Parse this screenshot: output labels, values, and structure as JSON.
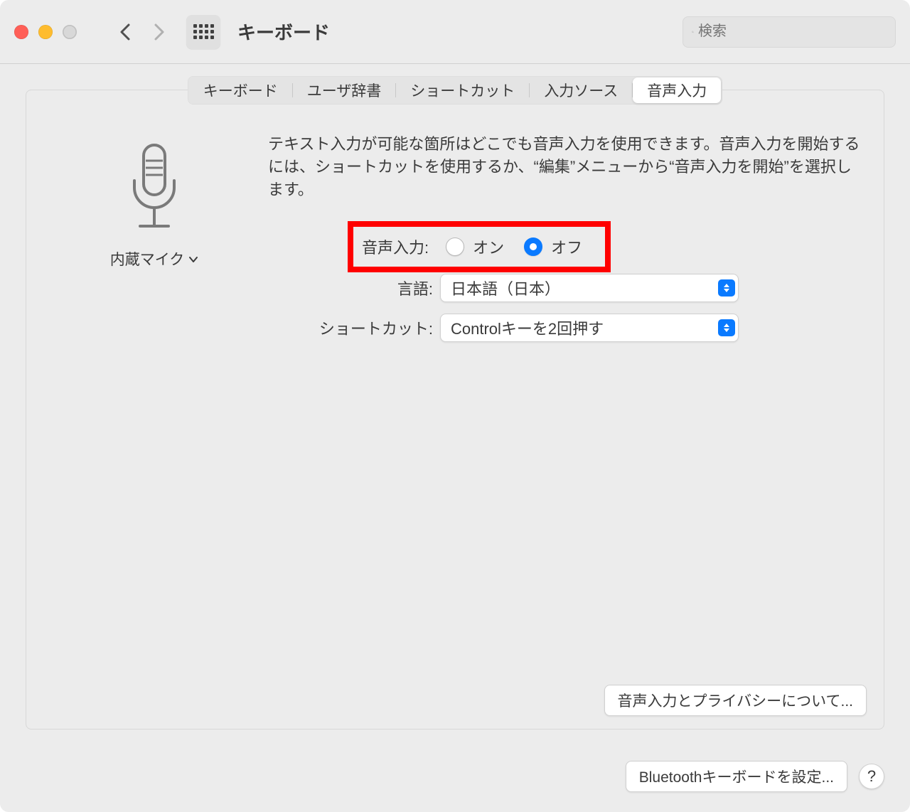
{
  "toolbar": {
    "title": "キーボード",
    "search_placeholder": "検索"
  },
  "tabs": [
    {
      "label": "キーボード"
    },
    {
      "label": "ユーザ辞書"
    },
    {
      "label": "ショートカット"
    },
    {
      "label": "入力ソース"
    },
    {
      "label": "音声入力",
      "active": true
    }
  ],
  "mic": {
    "label": "内蔵マイク"
  },
  "description": "テキスト入力が可能な箇所はどこでも音声入力を使用できます。音声入力を開始するには、ショートカットを使用するか、“編集”メニューから“音声入力を開始”を選択します。",
  "fields": {
    "dictation_label": "音声入力:",
    "on_label": "オン",
    "off_label": "オフ",
    "language_label": "言語:",
    "language_value": "日本語（日本）",
    "shortcut_label": "ショートカット:",
    "shortcut_value": "Controlキーを2回押す"
  },
  "buttons": {
    "privacy": "音声入力とプライバシーについて...",
    "bluetooth": "Bluetoothキーボードを設定...",
    "help": "?"
  }
}
